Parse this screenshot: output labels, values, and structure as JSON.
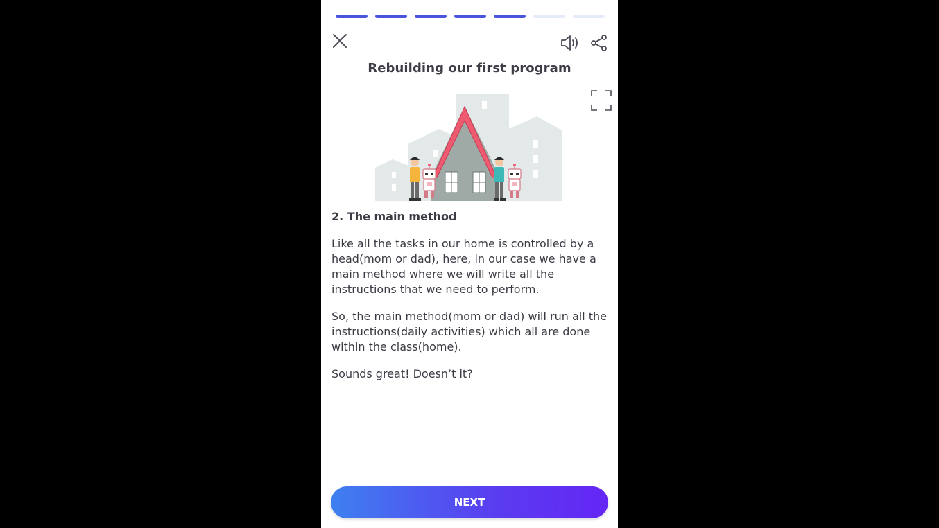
{
  "progress": {
    "total_steps": 7,
    "completed_steps": 5,
    "done_color": "#4a55dc",
    "todo_color": "#e6ebfb"
  },
  "header": {
    "close_icon": "close-icon",
    "sound_icon": "speaker-icon",
    "share_icon": "share-icon"
  },
  "lesson": {
    "title": "Rebuilding our first program",
    "illustration": "house-with-people-and-robots",
    "expand_icon": "fullscreen-icon",
    "section_heading": "2. The main method",
    "paragraphs": [
      "Like all the tasks in our home is controlled by a head(mom or dad), here, in our case we have a main method where we will write all the instructions that we need to perform.",
      "So, the main method(mom or dad) will run all the instructions(daily activities) which all are done within the class(home).",
      "Sounds great! Doesn’t it?"
    ]
  },
  "footer": {
    "next_label": "NEXT",
    "gradient_start": "#3e80f0",
    "gradient_end": "#6426f5"
  }
}
